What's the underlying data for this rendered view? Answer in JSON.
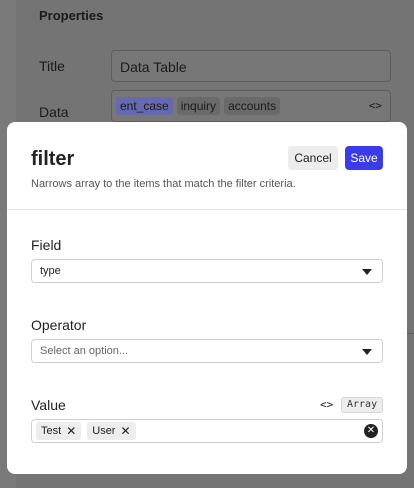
{
  "background": {
    "panel_title": "Properties",
    "title_label": "Title",
    "title_value": "Data Table",
    "data_label": "Data",
    "data_chips": [
      "ent_case",
      "inquiry",
      "accounts"
    ],
    "code_icon": "<>"
  },
  "modal": {
    "title": "filter",
    "subtitle": "Narrows array to the items that match the filter criteria.",
    "cancel_label": "Cancel",
    "save_label": "Save",
    "fields": {
      "field_label": "Field",
      "field_value": "type",
      "operator_label": "Operator",
      "operator_placeholder": "Select an option...",
      "value_label": "Value",
      "value_code_icon": "<>",
      "value_type_badge": "Array",
      "value_tags": [
        "Test",
        "User"
      ]
    }
  },
  "colors": {
    "accent": "#3b3be8",
    "overlay": "#6b6b6b"
  }
}
